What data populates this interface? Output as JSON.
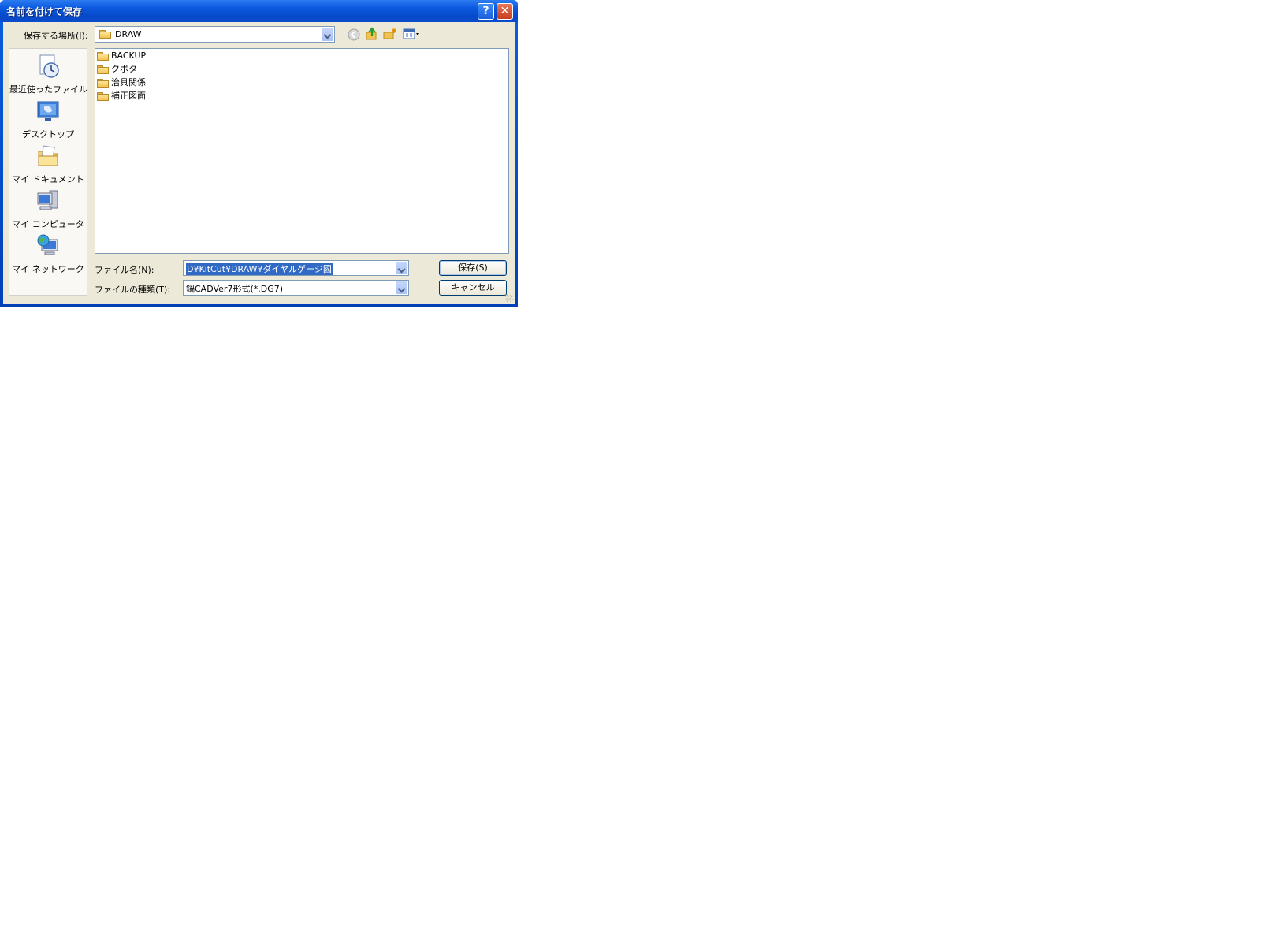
{
  "window": {
    "title": "名前を付けて保存",
    "help_glyph": "?",
    "close_glyph": "✕"
  },
  "location": {
    "label": "保存する場所(I):",
    "current": "DRAW"
  },
  "toolbar": {
    "icons": [
      "back-icon",
      "up-folder-icon",
      "new-folder-icon",
      "view-menu-icon"
    ]
  },
  "places": [
    {
      "label": "最近使ったファイル",
      "icon": "recent-documents-icon"
    },
    {
      "label": "デスクトップ",
      "icon": "desktop-icon"
    },
    {
      "label": "マイ ドキュメント",
      "icon": "my-documents-icon"
    },
    {
      "label": "マイ コンピュータ",
      "icon": "my-computer-icon"
    },
    {
      "label": "マイ ネットワーク",
      "icon": "my-network-icon"
    }
  ],
  "files": [
    {
      "name": "BACKUP"
    },
    {
      "name": "クボタ"
    },
    {
      "name": "治具関係"
    },
    {
      "name": "補正図面"
    }
  ],
  "filename": {
    "label": "ファイル名(N):",
    "value": "D¥KitCut¥DRAW¥ダイヤルゲージ図"
  },
  "filetype": {
    "label": "ファイルの種類(T):",
    "value": "鍋CADVer7形式(*.DG7)"
  },
  "buttons": {
    "save": "保存(S)",
    "cancel": "キャンセル"
  },
  "colors": {
    "title_bar": "#0c5ae0",
    "client_bg": "#ece9d8",
    "selection": "#316ac5"
  }
}
